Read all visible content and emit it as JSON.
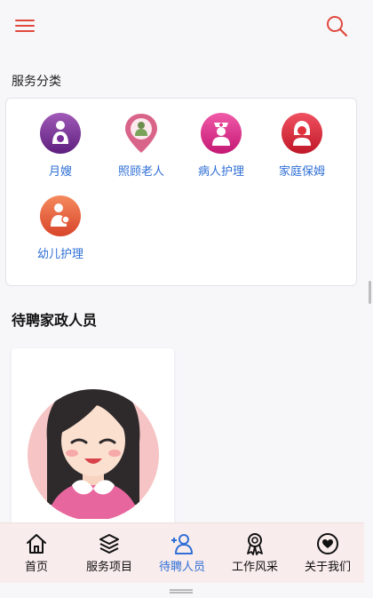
{
  "header": {
    "menu_icon": "hamburger-menu-icon",
    "search_icon": "search-icon",
    "accent": "#e0483c"
  },
  "services": {
    "section_title": "服务分类",
    "items": [
      {
        "label": "月嫂",
        "icon": "mother-baby-icon",
        "color": "#7a2f9a"
      },
      {
        "label": "照顾老人",
        "icon": "elderly-care-pin-icon",
        "color": "#d9648a"
      },
      {
        "label": "病人护理",
        "icon": "nurse-icon",
        "color": "#e0308a"
      },
      {
        "label": "家庭保姆",
        "icon": "housekeeper-icon",
        "color": "#e0303c"
      },
      {
        "label": "幼儿护理",
        "icon": "child-care-icon",
        "color": "#e8603c"
      }
    ]
  },
  "waiting": {
    "title": "待聘家政人员"
  },
  "tabbar": {
    "active_color": "#2f6fd6",
    "items": [
      {
        "label": "首页",
        "icon": "home-icon"
      },
      {
        "label": "服务项目",
        "icon": "layers-icon"
      },
      {
        "label": "待聘人员",
        "icon": "add-user-icon"
      },
      {
        "label": "工作风采",
        "icon": "award-icon"
      },
      {
        "label": "关于我们",
        "icon": "heart-icon"
      }
    ]
  }
}
